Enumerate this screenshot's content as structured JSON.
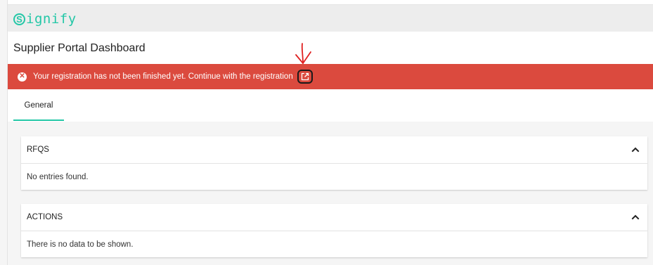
{
  "brand": {
    "logo_initial": "S",
    "logo_text": "ignify",
    "accent": "#24c7a7"
  },
  "header": {
    "title": "Supplier Portal Dashboard"
  },
  "banner": {
    "message": "Your registration has not been finished yet. Continue with the registration",
    "color": "#db4a3e",
    "icon": "error-circle-icon",
    "link_icon": "external-link-icon"
  },
  "tabs": [
    {
      "label": "General",
      "active": true
    }
  ],
  "cards": [
    {
      "title": "RFQS",
      "body": "No entries found.",
      "icon": "chevron-up-icon"
    },
    {
      "title": "ACTIONS",
      "body": "There is no data to be shown.",
      "icon": "chevron-up-icon"
    }
  ]
}
